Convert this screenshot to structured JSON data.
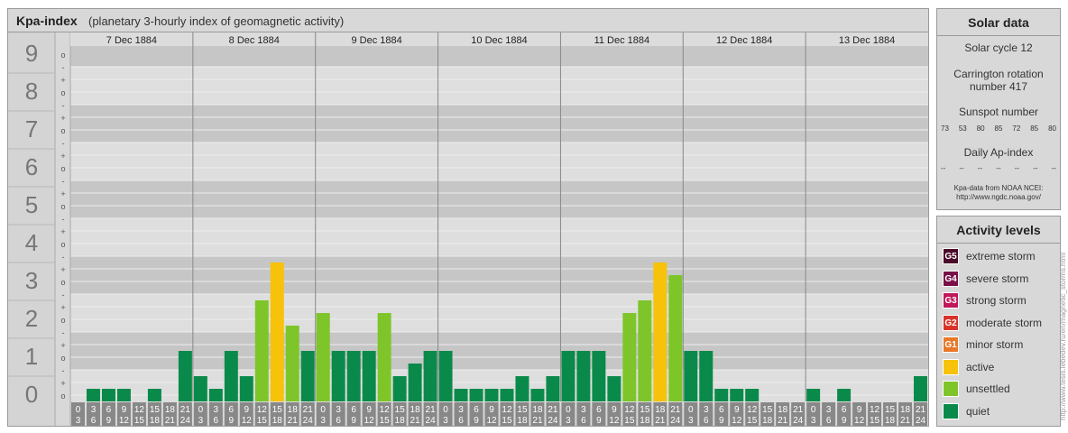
{
  "header": {
    "title": "Kpa-index",
    "subtitle": "(planetary 3-hourly index of geomagnetic activity)"
  },
  "chart_data": {
    "type": "bar",
    "ylim": [
      0,
      9
    ],
    "y_ticks": [
      "0",
      "1",
      "2",
      "3",
      "4",
      "5",
      "6",
      "7",
      "8",
      "9"
    ],
    "y_minor_ticks": [
      "o",
      "+",
      "-",
      "o",
      "+",
      "-",
      "o",
      "+",
      "-",
      "o",
      "+",
      "-",
      "o",
      "+",
      "-",
      "o",
      "+",
      "-",
      "o",
      "+",
      "-",
      "o",
      "+",
      "-",
      "o",
      "+",
      "-",
      "o"
    ],
    "days": [
      "7 Dec 1884",
      "8 Dec 1884",
      "9 Dec 1884",
      "10 Dec 1884",
      "11 Dec 1884",
      "12 Dec 1884",
      "13 Dec 1884"
    ],
    "interval_labels": [
      [
        "0",
        "3"
      ],
      [
        "3",
        "6"
      ],
      [
        "6",
        "9"
      ],
      [
        "9",
        "12"
      ],
      [
        "12",
        "15"
      ],
      [
        "15",
        "18"
      ],
      [
        "18",
        "21"
      ],
      [
        "21",
        "24"
      ]
    ],
    "values": [
      0,
      0.333,
      0.333,
      0.333,
      0,
      0.333,
      0,
      1.333,
      0.667,
      0.333,
      1.333,
      0.667,
      2.667,
      3.667,
      2,
      1.333,
      2.333,
      1.333,
      1.333,
      1.333,
      2.333,
      0.667,
      1,
      1.333,
      1.333,
      0.333,
      0.333,
      0.333,
      0.333,
      0.667,
      0.333,
      0.667,
      1.333,
      1.333,
      1.333,
      0.667,
      2.333,
      2.667,
      3.667,
      3.333,
      1.333,
      1.333,
      0.333,
      0.333,
      0.333,
      0,
      0,
      0,
      0.333,
      0,
      0.333,
      0,
      0,
      0,
      0,
      0.667
    ],
    "colors": {
      "quiet": "#0a8a4a",
      "unsettled": "#7ec52a",
      "active": "#f7c20a"
    }
  },
  "solar": {
    "title": "Solar data",
    "cycle": "Solar cycle 12",
    "rotation_line1": "Carrington rotation",
    "rotation_line2": "number 417",
    "sunspot_title": "Sunspot number",
    "sunspots": [
      "73",
      "53",
      "80",
      "85",
      "72",
      "85",
      "80"
    ],
    "ap_title": "Daily Ap-index",
    "ap_values": [
      "--",
      "--",
      "--",
      "--",
      "--",
      "--",
      "--"
    ],
    "source_line1": "Kpa-data from NOAA NCEI:",
    "source_line2": "http://www.ngdc.noaa.gov/"
  },
  "activity": {
    "title": "Activity levels",
    "items": [
      {
        "badge": "G5",
        "label": "extreme storm",
        "color": "#4a0a2a"
      },
      {
        "badge": "G4",
        "label": "severe storm",
        "color": "#7a1048"
      },
      {
        "badge": "G3",
        "label": "strong storm",
        "color": "#c0185a"
      },
      {
        "badge": "G2",
        "label": "moderate storm",
        "color": "#d8342a"
      },
      {
        "badge": "G1",
        "label": "minor storm",
        "color": "#e8782a"
      },
      {
        "badge": "",
        "label": "active",
        "color": "#f7c20a"
      },
      {
        "badge": "",
        "label": "unsettled",
        "color": "#7ec52a"
      },
      {
        "badge": "",
        "label": "quiet",
        "color": "#0a8a4a"
      }
    ]
  },
  "credit": "http://www.tesis.lebedev.ru/en/magnetic_storms.html"
}
